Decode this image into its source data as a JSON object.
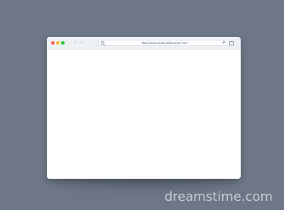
{
  "window": {
    "controls": [
      {
        "name": "close",
        "color": "#ff5f57"
      },
      {
        "name": "minimize",
        "color": "#ffbd2e"
      },
      {
        "name": "maximize",
        "color": "#28c840"
      }
    ],
    "nav": {
      "back_glyph": "‹",
      "forward_glyph": "›"
    },
    "address": {
      "url": "http://www.mostcuttbrowser.ever",
      "search_icon": "search-icon",
      "reload_glyph": "↻"
    },
    "toolbar": {
      "new_tab_glyph": "+",
      "tabs_icon": "tabs-icon"
    }
  },
  "watermark": {
    "text": "dreamstime.com"
  },
  "colors": {
    "background": "#6d7787",
    "window_chrome": "#eef1f4",
    "content": "#ffffff",
    "address_text": "#5e6877",
    "icon": "#8a94a3"
  }
}
